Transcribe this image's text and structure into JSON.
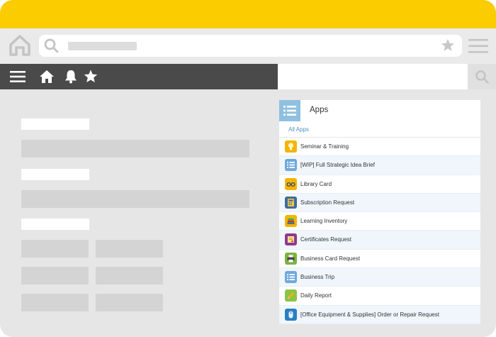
{
  "browser": {
    "home_icon": "home-icon",
    "search_icon": "search-icon",
    "bookmark_icon": "star-icon",
    "menu_icon": "hamburger-icon"
  },
  "appbar": {
    "icons": [
      "menu-icon",
      "home-icon",
      "bell-icon",
      "star-icon"
    ]
  },
  "apps_panel": {
    "title": "Apps",
    "all_apps_link": "All Apps",
    "items": [
      {
        "label": "Seminar & Training",
        "icon": "lightbulb-icon",
        "color": "#f4b400"
      },
      {
        "label": "[WIP] Full Strategic Idea Brief",
        "icon": "list-icon",
        "color": "#6fa8dc"
      },
      {
        "label": "Library Card",
        "icon": "glasses-icon",
        "color": "#f4b400"
      },
      {
        "label": "Subscription Request",
        "icon": "calculator-icon",
        "color": "#3d6b9e"
      },
      {
        "label": "Learning Inventory",
        "icon": "books-icon",
        "color": "#f4b400"
      },
      {
        "label": "Certificates Request",
        "icon": "certificate-icon",
        "color": "#8e3a8e"
      },
      {
        "label": "Business Card Request",
        "icon": "printer-icon",
        "color": "#7cb342"
      },
      {
        "label": "Business Trip",
        "icon": "list-icon",
        "color": "#6fa8dc"
      },
      {
        "label": "Daily Report",
        "icon": "pencil-icon",
        "color": "#8bc34a"
      },
      {
        "label": "[Office Equipment & Supplies] Order or Repair Request",
        "icon": "mouse-icon",
        "color": "#2b7fc3"
      }
    ]
  },
  "colors": {
    "titlebar": "#fbcd00",
    "appbar": "#4a4a4a",
    "link": "#4a90c8",
    "panel_accent": "#8fc0e0",
    "row_alt": "#f0f6fc"
  }
}
